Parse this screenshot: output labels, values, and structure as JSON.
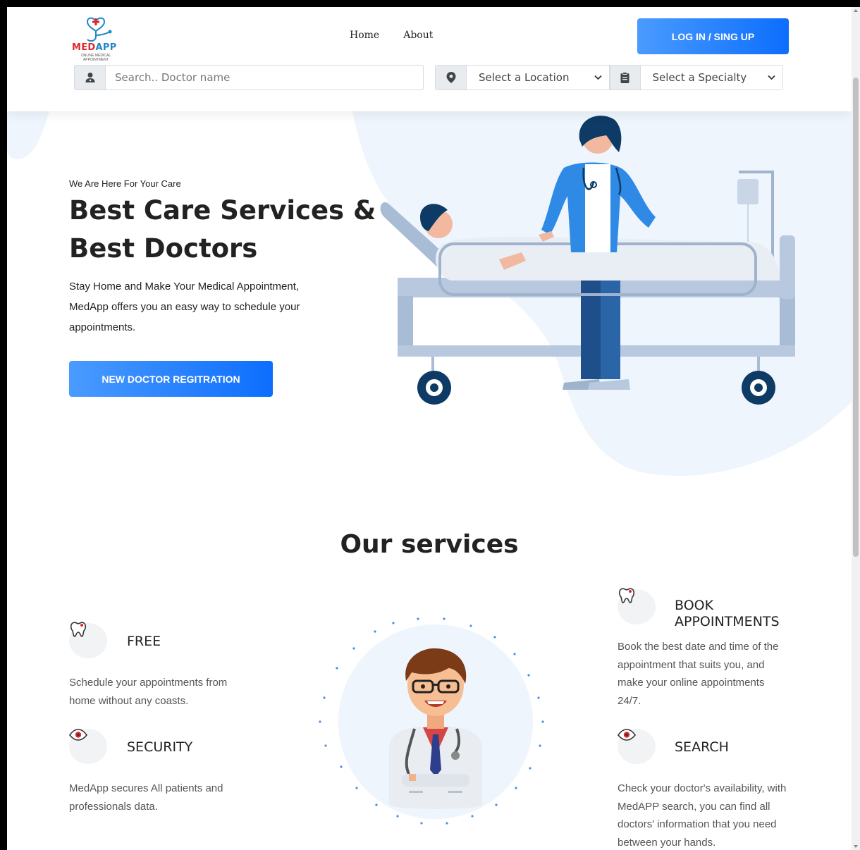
{
  "brand": {
    "name_part1": "MED",
    "name_part2": "APP",
    "tagline": "ONLINE MEDICAL APPOINTMENT"
  },
  "nav": {
    "items": [
      {
        "label": "Home"
      },
      {
        "label": "About"
      }
    ],
    "login_label": "LOG IN / SING UP"
  },
  "search": {
    "doctor_placeholder": "Search.. Doctor name",
    "location_selected": "Select a Location",
    "specialty_selected": "Select a Specialty"
  },
  "hero": {
    "tagline": "We Are Here For Your Care",
    "title_line1": "Best Care Services &",
    "title_line2": "Best Doctors",
    "description": "Stay Home and Make Your Medical Appointment, MedApp offers you an easy way to schedule your appointments.",
    "register_label": "NEW DOCTOR REGITRATION"
  },
  "services": {
    "heading": "Our services",
    "items": [
      {
        "title": "FREE",
        "icon": "tooth-icon",
        "text": "Schedule your appointments from home without any coasts."
      },
      {
        "title": "SECURITY",
        "icon": "eye-icon",
        "text": "MedApp secures All patients and professionals data."
      },
      {
        "title": "BOOK APPOINTMENTS",
        "icon": "tooth-icon",
        "text": "Book the best date and time of the appointment that suits you, and make your online appointments 24/7."
      },
      {
        "title": "SEARCH",
        "icon": "eye-icon",
        "text": "Check your doctor's availability, with MedAPP search, you can find all doctors' information that you need between your hands."
      }
    ]
  },
  "colors": {
    "primary": "#0d6efd",
    "primary_light": "#4a9bff",
    "hero_blob": "#eef5fd",
    "brand_red": "#e0242e",
    "brand_blue": "#1e88c8"
  }
}
